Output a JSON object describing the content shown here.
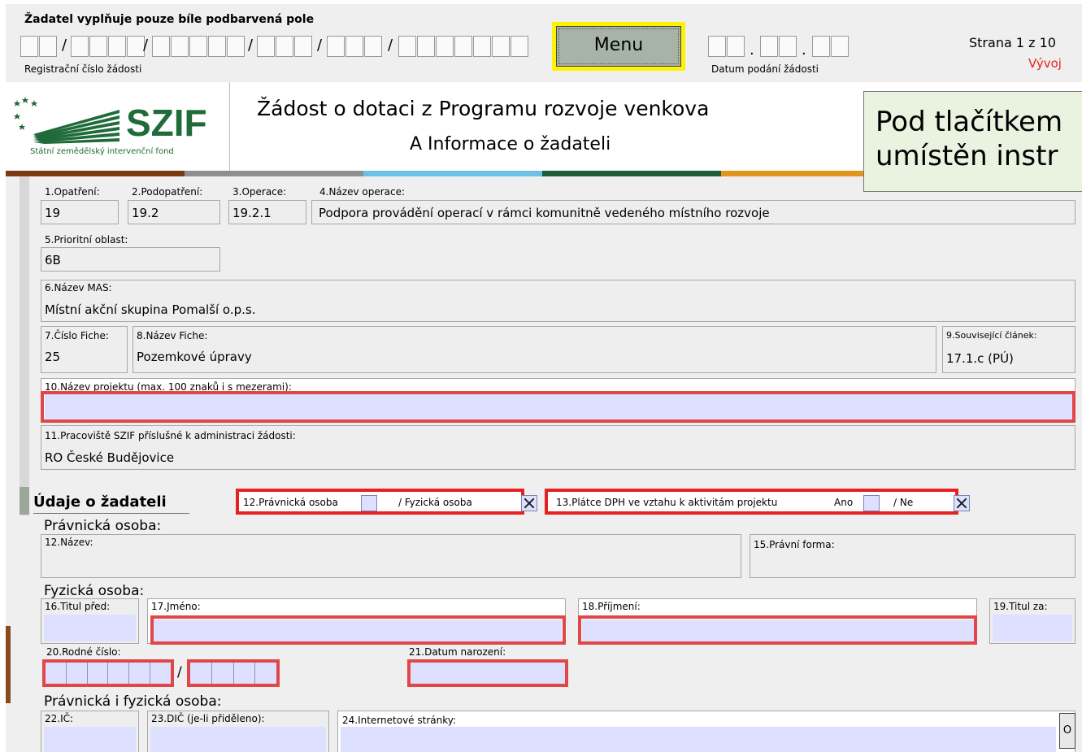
{
  "header": {
    "instruction": "Žadatel vyplňuje pouze bíle podbarvená pole",
    "reg_label": "Registrační číslo žádosti",
    "date_label": "Datum podání žádosti",
    "menu_label": "Menu",
    "page_label": "Strana 1 z 10",
    "dev_label": "Vývoj",
    "slash": "/",
    "dot": "."
  },
  "logo": {
    "brand": "SZIF",
    "subtitle": "Státní zemědělský intervenční fond"
  },
  "title": {
    "line1": "Žádost o dotaci z Programu rozvoje venkova",
    "line2": "A Informace o žadateli"
  },
  "callout": {
    "line1": "Pod tlačítkem",
    "line2": "umístěn instr"
  },
  "stripe_colors": [
    "#7b3b12",
    "#8f8f8f",
    "#6fc0e8",
    "#1f5c3a",
    "#e0961a"
  ],
  "fields": {
    "opatreni": {
      "label": "1.Opatření:",
      "value": "19"
    },
    "podopatreni": {
      "label": "2.Podopatření:",
      "value": "19.2"
    },
    "operace": {
      "label": "3.Operace:",
      "value": "19.2.1"
    },
    "nazev_operace": {
      "label": "4.Název operace:",
      "value": "Podpora provádění operací v rámci komunitně vedeného místního rozvoje"
    },
    "prioritni_oblast": {
      "label": "5.Prioritní oblast:",
      "value": "6B"
    },
    "nazev_mas": {
      "label": "6.Název MAS:",
      "value": "Místní akční skupina Pomalší o.p.s."
    },
    "cislo_fiche": {
      "label": "7.Číslo Fiche:",
      "value": "25"
    },
    "nazev_fiche": {
      "label": "8.Název Fiche:",
      "value": "Pozemkové úpravy"
    },
    "clanek": {
      "label": "9.Související článek:",
      "value": "17.1.c (PÚ)"
    },
    "nazev_projektu": {
      "label": "10.Název projektu (max. 100 znaků i s mezerami):",
      "value": ""
    },
    "pracoviste": {
      "label": "11.Pracoviště SZIF příslušné k administraci žádosti:",
      "value": "RO České Budějovice"
    }
  },
  "applicant": {
    "section_title": "Údaje o žadateli",
    "legal_choice": {
      "label_a": "12.Právnická osoba",
      "label_b": "/  Fyzická osoba"
    },
    "vat": {
      "label": "13.Plátce DPH ve vztahu k aktivitám projektu",
      "ano": "Ano",
      "ne": "/  Ne"
    },
    "legal_heading": "Právnická osoba:",
    "nazev": "12.Název:",
    "pravni_forma": "15.Právní forma:",
    "natural_heading": "Fyzická osoba:",
    "titul_pred": "16.Titul před:",
    "jmeno": "17.Jméno:",
    "prijmeni": "18.Příjmení:",
    "titul_za": "19.Titul za:",
    "rodne_cislo": "20.Rodné číslo:",
    "datum_narozeni": "21.Datum narození:",
    "both_heading": "Právnická i fyzická osoba:",
    "ic": "22.IČ:",
    "dic": "23.DIČ (je-li přiděleno):",
    "web": "24.Internetové stránky:",
    "web_btn": "O"
  }
}
